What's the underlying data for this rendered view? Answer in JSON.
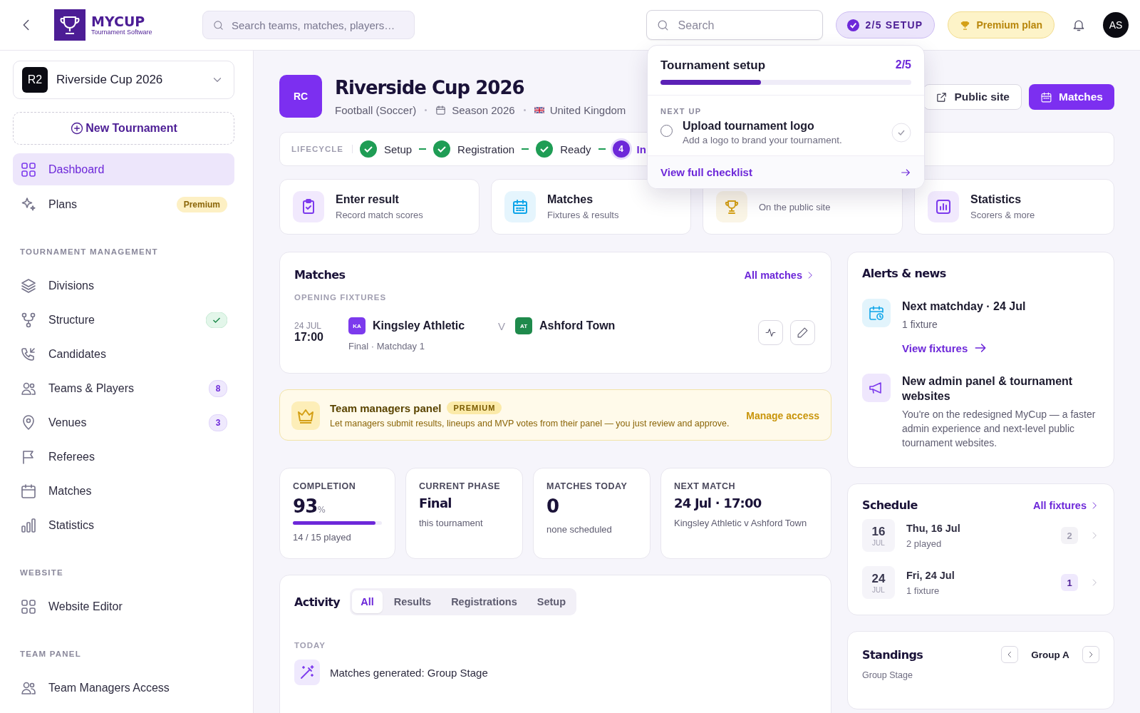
{
  "header": {
    "brand": "MYCUP",
    "brand_sub": "Tournament Software",
    "search_placeholder": "Search teams, matches, players…",
    "search2_placeholder": "Search",
    "setup_badge": "2/5 SETUP",
    "premium": "Premium plan",
    "avatar": "AS"
  },
  "sidebar": {
    "tournament": {
      "code": "R2",
      "name": "Riverside Cup 2026"
    },
    "new_button": "New Tournament",
    "top_items": [
      {
        "label": "Dashboard",
        "selected": true,
        "kind": "plain"
      },
      {
        "label": "Plans",
        "selected": false,
        "badge": "Premium",
        "kind": "premium"
      }
    ],
    "sections": [
      {
        "title": "TOURNAMENT MANAGEMENT",
        "items": [
          {
            "label": "Divisions",
            "selected": false
          },
          {
            "label": "Structure",
            "selected": false,
            "done": true
          },
          {
            "label": "Candidates",
            "selected": false
          },
          {
            "label": "Teams & Players",
            "selected": false,
            "badge": "8"
          },
          {
            "label": "Venues",
            "selected": false,
            "badge": "3"
          },
          {
            "label": "Referees",
            "selected": false
          },
          {
            "label": "Matches",
            "selected": false
          },
          {
            "label": "Statistics",
            "selected": false
          }
        ]
      },
      {
        "title": "WEBSITE",
        "items": [
          {
            "label": "Website Editor",
            "selected": false
          }
        ]
      },
      {
        "title": "TEAM PANEL",
        "items": [
          {
            "label": "Team Managers Access",
            "selected": false
          }
        ]
      }
    ]
  },
  "page": {
    "logo": "RC",
    "title": "Riverside Cup 2026",
    "sport": "Football (Soccer)",
    "season": "Season 2026",
    "country": "United Kingdom",
    "buttons": [
      {
        "label": "Public site",
        "kind": "outline"
      },
      {
        "label": "Matches",
        "kind": "primary"
      }
    ]
  },
  "lifecycle": {
    "label": "LIFECYCLE",
    "steps": [
      {
        "label": "Setup",
        "done": true
      },
      {
        "label": "Registration",
        "done": true
      },
      {
        "label": "Ready",
        "done": true
      },
      {
        "number": "4",
        "label": "In",
        "done": false
      }
    ]
  },
  "quick_actions": [
    {
      "title": "Enter result",
      "subtitle": "Record match scores",
      "color": "#7c3aed"
    },
    {
      "title": "Matches",
      "subtitle": "Fixtures & results",
      "color": "#0ea5e9"
    },
    {
      "subtitle": "On the public site",
      "color": "#d4a017"
    },
    {
      "title": "Statistics",
      "subtitle": "Scorers & more",
      "color": "#7c3aed"
    }
  ],
  "setup_popover": {
    "title": "Tournament setup",
    "count": "2/5",
    "level": 0.4,
    "next_label": "NEXT UP",
    "task": {
      "title": "Upload tournament logo",
      "description": "Add a logo to brand your tournament.",
      "done": false
    },
    "link": "View full checklist"
  },
  "matches": {
    "title": "Matches",
    "link": "All matches",
    "section": "OPENING FIXTURES",
    "fixtures": [
      {
        "date": "24 JUL",
        "time": "17:00",
        "home": {
          "code": "KA",
          "name": "Kingsley Athletic",
          "color": "#7c3aed"
        },
        "vs": "V",
        "away": {
          "code": "AT",
          "name": "Ashford Town",
          "color": "#1f8a4c"
        },
        "detail": "Final · Matchday 1"
      }
    ]
  },
  "promo": {
    "title": "Team managers panel",
    "badge": "PREMIUM",
    "text": "Let managers submit results, lineups and MVP votes from their panel — you just review and approve.",
    "link": "Manage access"
  },
  "stats": [
    {
      "label": "COMPLETION",
      "value": "93",
      "unit": "%",
      "level": 0.93,
      "sub": "14 / 15 played",
      "kind": "progress"
    },
    {
      "label": "CURRENT PHASE",
      "value": "Final",
      "sub": "this tournament",
      "kind": "small"
    },
    {
      "label": "MATCHES TODAY",
      "value": "0",
      "sub": "none scheduled",
      "kind": "big"
    },
    {
      "label": "NEXT MATCH",
      "value": "24 Jul · 17:00",
      "sub": "Kingsley Athletic v Ashford Town",
      "kind": "small"
    }
  ],
  "activity": {
    "title": "Activity",
    "tabs": [
      {
        "label": "All",
        "selected": true
      },
      {
        "label": "Results",
        "selected": false
      },
      {
        "label": "Registrations",
        "selected": false
      },
      {
        "label": "Setup",
        "selected": false
      }
    ],
    "group": "TODAY",
    "items": [
      {
        "text": "Matches generated: Group Stage"
      }
    ]
  },
  "alerts": {
    "title": "Alerts & news",
    "items": [
      {
        "title": "Next matchday · 24 Jul",
        "text": "1 fixture",
        "link": "View fixtures",
        "color": "#0ea5e9"
      },
      {
        "title": "New admin panel & tournament websites",
        "text": "You're on the redesigned MyCup — a faster admin experience and next-level public tournament websites.",
        "color": "#7c3aed"
      }
    ]
  },
  "schedule": {
    "title": "Schedule",
    "link": "All fixtures",
    "days": [
      {
        "day": "16",
        "month": "JUL",
        "label": "Thu, 16 Jul",
        "sub": "2 played",
        "count": "2",
        "upcoming": false
      },
      {
        "day": "24",
        "month": "JUL",
        "label": "Fri, 24 Jul",
        "sub": "1 fixture",
        "count": "1",
        "upcoming": true
      }
    ]
  },
  "standings": {
    "title": "Standings",
    "subtitle": "Group Stage",
    "group": "Group A"
  }
}
